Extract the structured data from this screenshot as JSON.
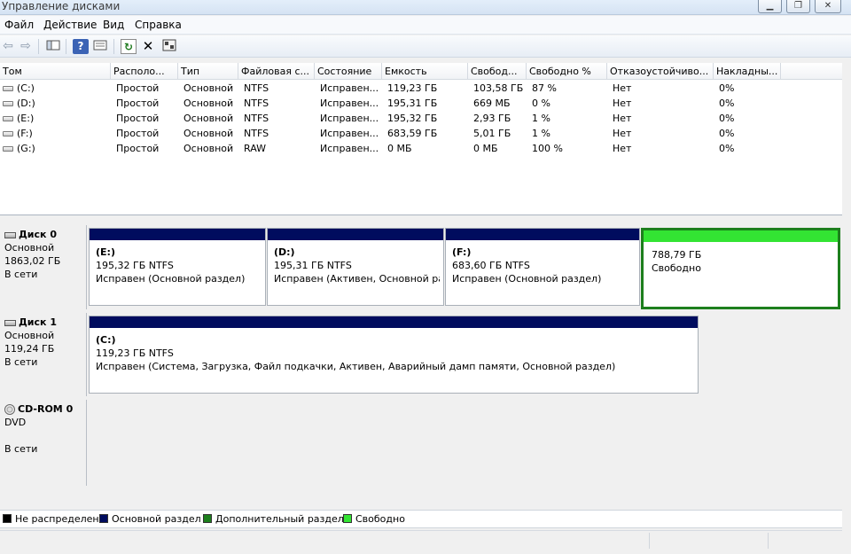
{
  "window": {
    "title": "Управление дисками",
    "minimize": "▁",
    "maximize": "❐",
    "close": "✕"
  },
  "menu": [
    "Файл",
    "Действие",
    "Вид",
    "Справка"
  ],
  "toolbar": {
    "back": "⇦",
    "forward": "⇨",
    "icons": [
      "console-tree-icon",
      "help-icon",
      "properties-icon",
      "refresh-icon",
      "delete-icon",
      "settings-icon"
    ],
    "refresh": "↻",
    "help": "?",
    "delete": "✕"
  },
  "volumes": {
    "columns": [
      "Том",
      "Располо...",
      "Тип",
      "Файловая с...",
      "Состояние",
      "Емкость",
      "Свобод...",
      "Свободно %",
      "Отказоустойчиво...",
      "Накладны..."
    ],
    "rows": [
      {
        "name": "(C:)",
        "layout": "Простой",
        "type": "Основной",
        "fs": "NTFS",
        "status": "Исправен...",
        "capacity": "119,23 ГБ",
        "free": "103,58 ГБ",
        "free_pct": "87 %",
        "fault": "Нет",
        "overhead": "0%"
      },
      {
        "name": "(D:)",
        "layout": "Простой",
        "type": "Основной",
        "fs": "NTFS",
        "status": "Исправен...",
        "capacity": "195,31 ГБ",
        "free": "669 МБ",
        "free_pct": "0 %",
        "fault": "Нет",
        "overhead": "0%"
      },
      {
        "name": "(E:)",
        "layout": "Простой",
        "type": "Основной",
        "fs": "NTFS",
        "status": "Исправен...",
        "capacity": "195,32 ГБ",
        "free": "2,93 ГБ",
        "free_pct": "1 %",
        "fault": "Нет",
        "overhead": "0%"
      },
      {
        "name": "(F:)",
        "layout": "Простой",
        "type": "Основной",
        "fs": "NTFS",
        "status": "Исправен...",
        "capacity": "683,59 ГБ",
        "free": "5,01 ГБ",
        "free_pct": "1 %",
        "fault": "Нет",
        "overhead": "0%"
      },
      {
        "name": "(G:)",
        "layout": "Простой",
        "type": "Основной",
        "fs": "RAW",
        "status": "Исправен...",
        "capacity": "0 МБ",
        "free": "0 МБ",
        "free_pct": "100 %",
        "fault": "Нет",
        "overhead": "0%"
      }
    ]
  },
  "disks": [
    {
      "name": "Диск 0",
      "type": "Основной",
      "size": "1863,02 ГБ",
      "status": "В сети",
      "partitions": [
        {
          "label": "(E:)",
          "size": "195,32 ГБ NTFS",
          "status": "Исправен (Основной раздел)"
        },
        {
          "label": "(D:)",
          "size": "195,31 ГБ NTFS",
          "status": "Исправен (Активен, Основной ра"
        },
        {
          "label": "(F:)",
          "size": "683,60 ГБ NTFS",
          "status": "Исправен (Основной раздел)"
        },
        {
          "label": "",
          "size": "788,79 ГБ",
          "status": "Свободно"
        }
      ]
    },
    {
      "name": "Диск 1",
      "type": "Основной",
      "size": "119,24 ГБ",
      "status": "В сети",
      "partitions": [
        {
          "label": "(C:)",
          "size": "119,23 ГБ NTFS",
          "status": "Исправен (Система, Загрузка, Файл подкачки, Активен, Аварийный дамп памяти, Основной раздел)"
        }
      ]
    },
    {
      "name": "CD-ROM 0",
      "type": "DVD",
      "size": "",
      "status": "В сети",
      "partitions": []
    }
  ],
  "legend": [
    {
      "label": "Не распределен",
      "color": "#000000"
    },
    {
      "label": "Основной раздел",
      "color": "#000c5e"
    },
    {
      "label": "Дополнительный раздел",
      "color": "#1d7f1d"
    },
    {
      "label": "Свободно",
      "color": "#33e433"
    }
  ]
}
